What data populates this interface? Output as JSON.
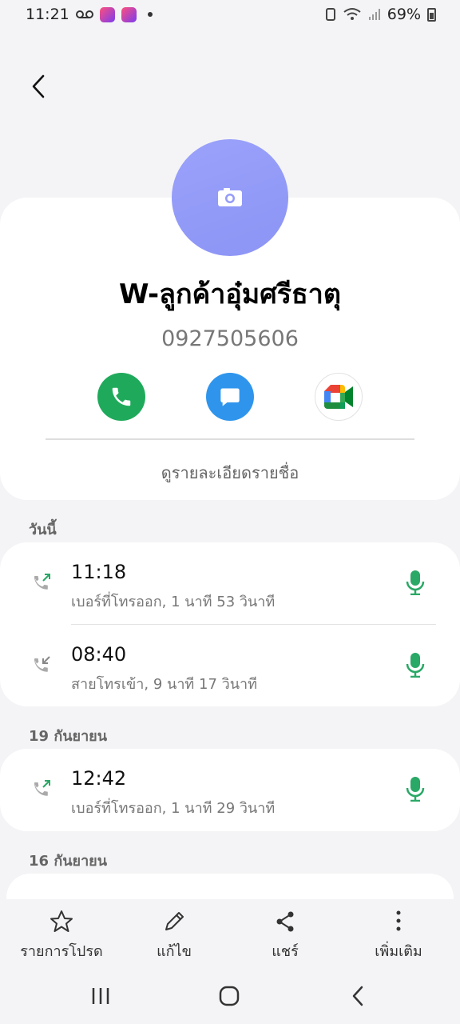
{
  "status_bar": {
    "time": "11:21",
    "battery": "69%",
    "notification_icons": [
      "voicemail-icon",
      "lazada-icon",
      "lazada-icon"
    ]
  },
  "contact": {
    "name": "W-ลูกค้าอุ๋มศรีธาตุ",
    "number": "0927505606",
    "avatar_color": "#959cf8",
    "details_link": "ดูรายละเอียดรายชื่อ"
  },
  "actions": [
    {
      "name": "call-icon",
      "color": "#1faa5b"
    },
    {
      "name": "message-icon",
      "color": "#2f95ec"
    },
    {
      "name": "google-meet-icon",
      "color": "#ffffff"
    }
  ],
  "call_log": [
    {
      "date": "วันนี้",
      "calls": [
        {
          "time": "11:18",
          "detail": "เบอร์ที่โทรออก, 1 นาที 53 วินาที",
          "type": "outgoing"
        },
        {
          "time": "08:40",
          "detail": "สายโทรเข้า, 9 นาที 17 วินาที",
          "type": "incoming"
        }
      ]
    },
    {
      "date": "19 กันยายน",
      "calls": [
        {
          "time": "12:42",
          "detail": "เบอร์ที่โทรออก, 1 นาที 29 วินาที",
          "type": "outgoing"
        }
      ]
    },
    {
      "date": "16 กันยายน",
      "calls": []
    }
  ],
  "bottom_bar": {
    "favorite": "รายการโปรด",
    "edit": "แก้ไข",
    "share": "แชร์",
    "more": "เพิ่มเติม"
  },
  "colors": {
    "accent_green": "#1faa5b",
    "mic_green": "#2aa866",
    "background": "#f4f4f6"
  }
}
